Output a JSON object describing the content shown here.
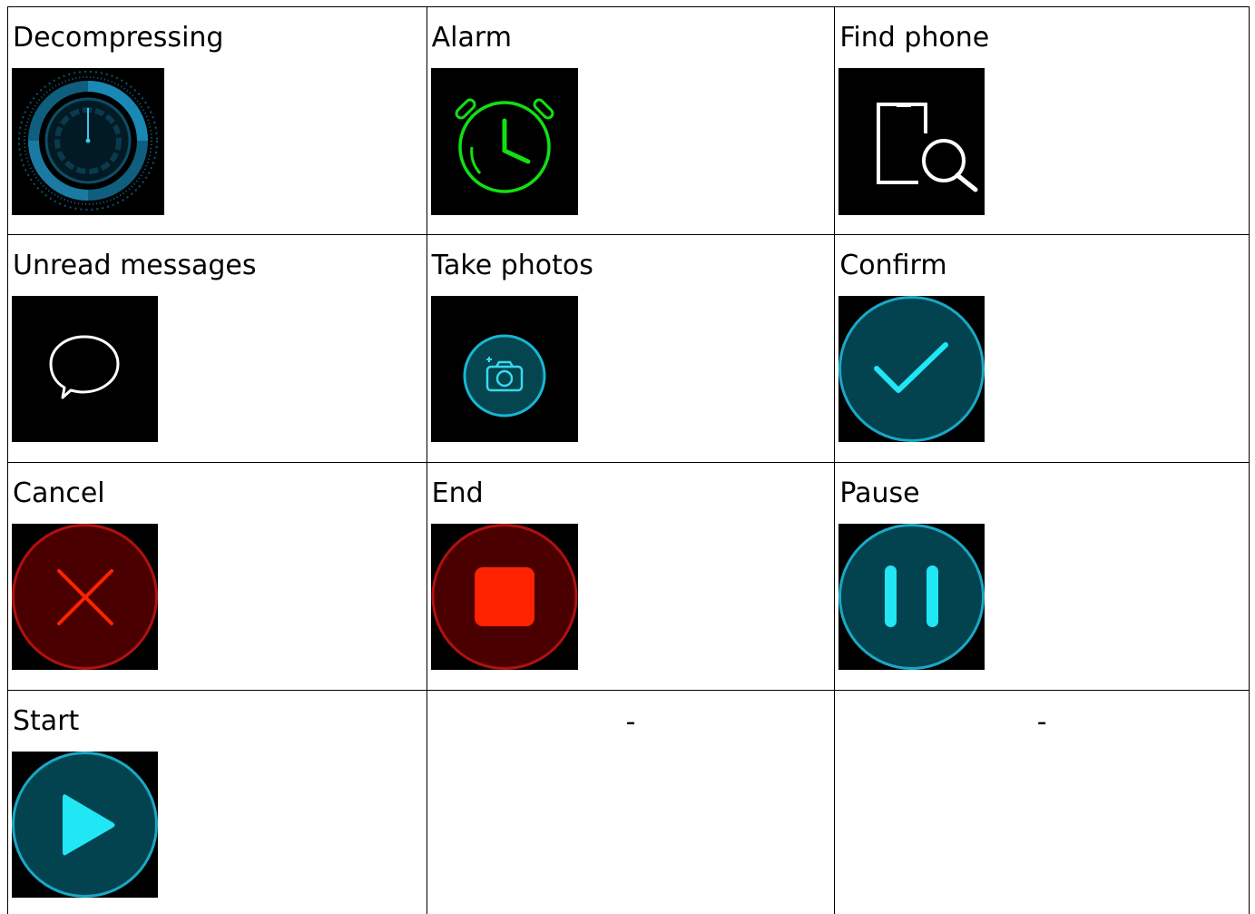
{
  "items": [
    {
      "label": "Decompressing",
      "icon": "decompressing-icon"
    },
    {
      "label": "Alarm",
      "icon": "alarm-icon"
    },
    {
      "label": "Find phone",
      "icon": "find-phone-icon"
    },
    {
      "label": "Unread messages",
      "icon": "message-icon"
    },
    {
      "label": "Take photos",
      "icon": "camera-icon"
    },
    {
      "label": "Confirm",
      "icon": "checkmark-icon"
    },
    {
      "label": "Cancel",
      "icon": "cancel-icon"
    },
    {
      "label": "End",
      "icon": "stop-icon"
    },
    {
      "label": "Pause",
      "icon": "pause-icon"
    },
    {
      "label": "Start",
      "icon": "play-icon"
    },
    {
      "label": "-",
      "icon": ""
    },
    {
      "label": "-",
      "icon": ""
    }
  ],
  "colors": {
    "tealFill": "#03424f",
    "tealRing": "#1aa7c4",
    "cyanGlyph": "#21e6f4",
    "redFill": "#4a0000",
    "redRing": "#b01010",
    "redGlyph": "#ff2200",
    "alarmGreen": "#12e012"
  }
}
